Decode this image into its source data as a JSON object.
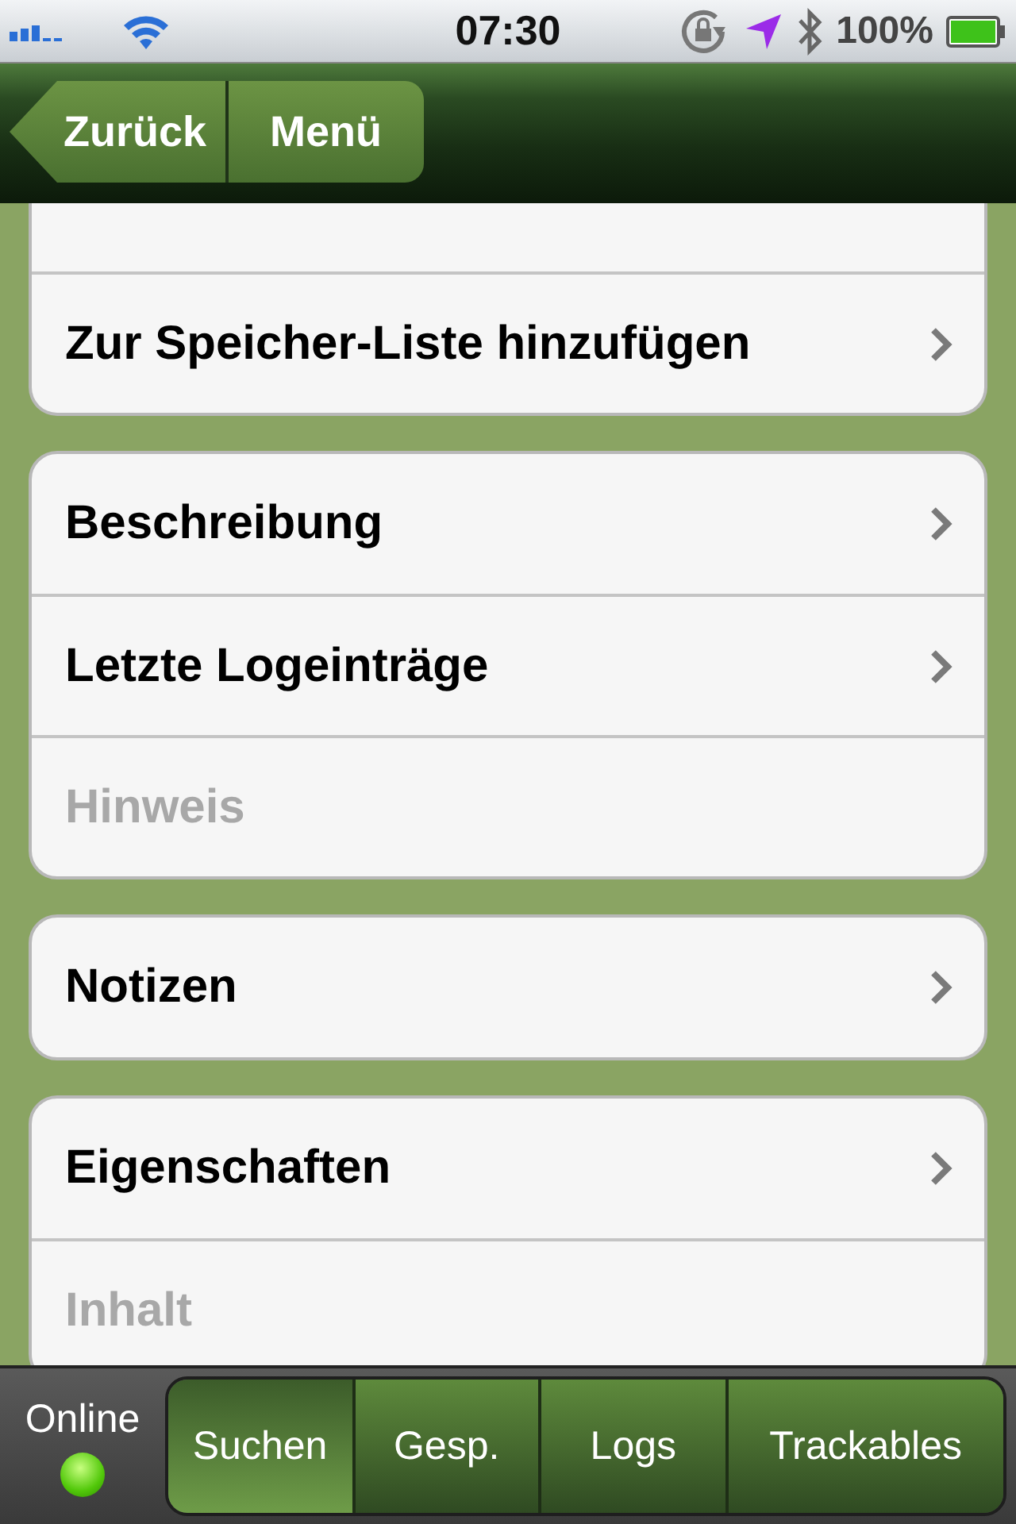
{
  "status_bar": {
    "time": "07:30",
    "battery": "100%"
  },
  "nav_bar": {
    "back_button": "Zurück",
    "menu_button": "Menü"
  },
  "groups": [
    {
      "rows": [
        {
          "label": "Zur Speicher-Liste hinzufügen",
          "disabled": false
        }
      ]
    },
    {
      "rows": [
        {
          "label": "Beschreibung",
          "disabled": false
        },
        {
          "label": "Letzte Logeinträge",
          "disabled": false
        },
        {
          "label": "Hinweis",
          "disabled": true
        }
      ]
    },
    {
      "rows": [
        {
          "label": "Notizen",
          "disabled": false
        }
      ]
    },
    {
      "rows": [
        {
          "label": "Eigenschaften",
          "disabled": false
        },
        {
          "label": "Inhalt",
          "disabled": true
        }
      ]
    }
  ],
  "tab_bar": {
    "status_label": "Online",
    "online": true,
    "tabs": [
      {
        "label": "Suchen",
        "selected": true
      },
      {
        "label": "Gesp.",
        "selected": false
      },
      {
        "label": "Logs",
        "selected": false
      },
      {
        "label": "Trackables",
        "selected": false
      }
    ]
  }
}
